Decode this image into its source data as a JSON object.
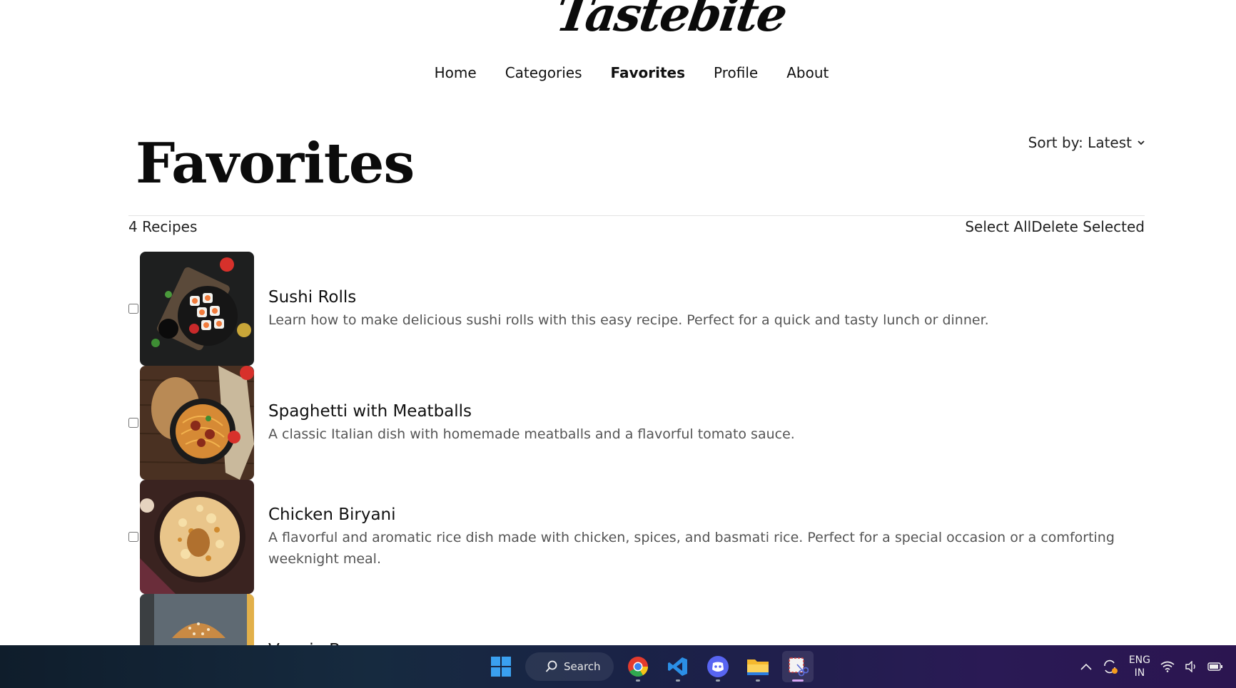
{
  "header": {
    "logo_text": "Tastebite",
    "nav": [
      {
        "label": "Home",
        "active": false
      },
      {
        "label": "Categories",
        "active": false
      },
      {
        "label": "Favorites",
        "active": true
      },
      {
        "label": "Profile",
        "active": false
      },
      {
        "label": "About",
        "active": false
      }
    ]
  },
  "page": {
    "title": "Favorites",
    "sort_label": "Sort by: Latest",
    "count_label": "4 Recipes",
    "select_all_label": "Select All",
    "delete_selected_label": "Delete Selected"
  },
  "recipes": [
    {
      "name": "Sushi Rolls",
      "description": "Learn how to make delicious sushi rolls with this easy recipe. Perfect for a quick and tasty lunch or dinner.",
      "image_icon": "sushi-image",
      "checked": false
    },
    {
      "name": "Spaghetti with Meatballs",
      "description": "A classic Italian dish with homemade meatballs and a flavorful tomato sauce.",
      "image_icon": "spaghetti-image",
      "checked": false
    },
    {
      "name": "Chicken Biryani",
      "description": "A flavorful and aromatic rice dish made with chicken, spices, and basmati rice. Perfect for a special occasion or a comforting weeknight meal.",
      "image_icon": "biryani-image",
      "checked": false
    },
    {
      "name": "Veggie Burger",
      "description": "",
      "image_icon": "burger-image",
      "checked": false
    }
  ],
  "taskbar": {
    "search_label": "Search",
    "lang_line1": "ENG",
    "lang_line2": "IN",
    "apps": [
      "windows-start-icon",
      "chrome-icon",
      "vscode-icon",
      "discord-icon",
      "file-explorer-icon",
      "snipping-tool-icon"
    ]
  },
  "colors": {
    "accent_text": "#111111",
    "muted_text": "#555555",
    "divider": "#e2e2e2"
  }
}
